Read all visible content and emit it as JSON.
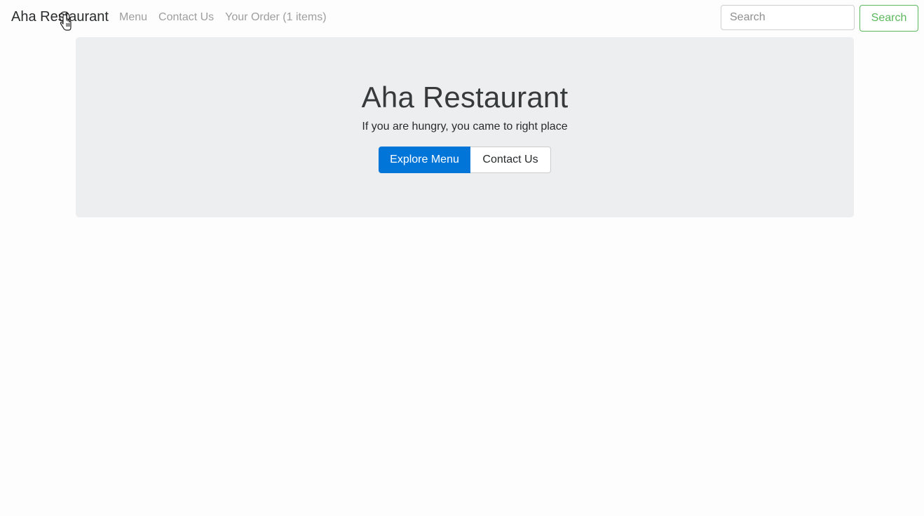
{
  "navbar": {
    "brand": "Aha Restaurant",
    "links": [
      {
        "label": "Menu"
      },
      {
        "label": "Contact Us"
      },
      {
        "label": "Your Order (1 items)"
      }
    ],
    "search": {
      "placeholder": "Search",
      "value": "",
      "button_label": "Search"
    }
  },
  "hero": {
    "title": "Aha Restaurant",
    "subtitle": "If you are hungry, you came to right place",
    "primary_button": "Explore Menu",
    "secondary_button": "Contact Us"
  },
  "icons": {
    "cursor": "hand-pointer-icon"
  },
  "colors": {
    "primary": "#0275d8",
    "success": "#5cb85c",
    "jumbotron_bg": "#eceeef",
    "nav_link": "#9e9e9e"
  }
}
